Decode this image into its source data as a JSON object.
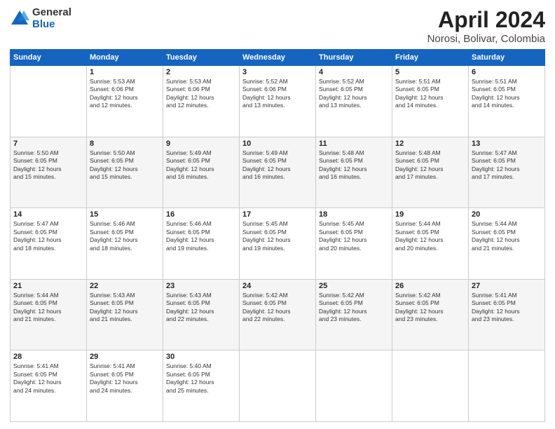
{
  "logo": {
    "general": "General",
    "blue": "Blue"
  },
  "title": "April 2024",
  "subtitle": "Norosi, Bolivar, Colombia",
  "days_of_week": [
    "Sunday",
    "Monday",
    "Tuesday",
    "Wednesday",
    "Thursday",
    "Friday",
    "Saturday"
  ],
  "weeks": [
    [
      {
        "day": "",
        "info": ""
      },
      {
        "day": "1",
        "info": "Sunrise: 5:53 AM\nSunset: 6:06 PM\nDaylight: 12 hours\nand 12 minutes."
      },
      {
        "day": "2",
        "info": "Sunrise: 5:53 AM\nSunset: 6:06 PM\nDaylight: 12 hours\nand 12 minutes."
      },
      {
        "day": "3",
        "info": "Sunrise: 5:52 AM\nSunset: 6:06 PM\nDaylight: 12 hours\nand 13 minutes."
      },
      {
        "day": "4",
        "info": "Sunrise: 5:52 AM\nSunset: 6:05 PM\nDaylight: 12 hours\nand 13 minutes."
      },
      {
        "day": "5",
        "info": "Sunrise: 5:51 AM\nSunset: 6:05 PM\nDaylight: 12 hours\nand 14 minutes."
      },
      {
        "day": "6",
        "info": "Sunrise: 5:51 AM\nSunset: 6:05 PM\nDaylight: 12 hours\nand 14 minutes."
      }
    ],
    [
      {
        "day": "7",
        "info": "Sunrise: 5:50 AM\nSunset: 6:05 PM\nDaylight: 12 hours\nand 15 minutes."
      },
      {
        "day": "8",
        "info": "Sunrise: 5:50 AM\nSunset: 6:05 PM\nDaylight: 12 hours\nand 15 minutes."
      },
      {
        "day": "9",
        "info": "Sunrise: 5:49 AM\nSunset: 6:05 PM\nDaylight: 12 hours\nand 16 minutes."
      },
      {
        "day": "10",
        "info": "Sunrise: 5:49 AM\nSunset: 6:05 PM\nDaylight: 12 hours\nand 16 minutes."
      },
      {
        "day": "11",
        "info": "Sunrise: 5:48 AM\nSunset: 6:05 PM\nDaylight: 12 hours\nand 16 minutes."
      },
      {
        "day": "12",
        "info": "Sunrise: 5:48 AM\nSunset: 6:05 PM\nDaylight: 12 hours\nand 17 minutes."
      },
      {
        "day": "13",
        "info": "Sunrise: 5:47 AM\nSunset: 6:05 PM\nDaylight: 12 hours\nand 17 minutes."
      }
    ],
    [
      {
        "day": "14",
        "info": "Sunrise: 5:47 AM\nSunset: 6:05 PM\nDaylight: 12 hours\nand 18 minutes."
      },
      {
        "day": "15",
        "info": "Sunrise: 5:46 AM\nSunset: 6:05 PM\nDaylight: 12 hours\nand 18 minutes."
      },
      {
        "day": "16",
        "info": "Sunrise: 5:46 AM\nSunset: 6:05 PM\nDaylight: 12 hours\nand 19 minutes."
      },
      {
        "day": "17",
        "info": "Sunrise: 5:45 AM\nSunset: 6:05 PM\nDaylight: 12 hours\nand 19 minutes."
      },
      {
        "day": "18",
        "info": "Sunrise: 5:45 AM\nSunset: 6:05 PM\nDaylight: 12 hours\nand 20 minutes."
      },
      {
        "day": "19",
        "info": "Sunrise: 5:44 AM\nSunset: 6:05 PM\nDaylight: 12 hours\nand 20 minutes."
      },
      {
        "day": "20",
        "info": "Sunrise: 5:44 AM\nSunset: 6:05 PM\nDaylight: 12 hours\nand 21 minutes."
      }
    ],
    [
      {
        "day": "21",
        "info": "Sunrise: 5:44 AM\nSunset: 6:05 PM\nDaylight: 12 hours\nand 21 minutes."
      },
      {
        "day": "22",
        "info": "Sunrise: 5:43 AM\nSunset: 6:05 PM\nDaylight: 12 hours\nand 21 minutes."
      },
      {
        "day": "23",
        "info": "Sunrise: 5:43 AM\nSunset: 6:05 PM\nDaylight: 12 hours\nand 22 minutes."
      },
      {
        "day": "24",
        "info": "Sunrise: 5:42 AM\nSunset: 6:05 PM\nDaylight: 12 hours\nand 22 minutes."
      },
      {
        "day": "25",
        "info": "Sunrise: 5:42 AM\nSunset: 6:05 PM\nDaylight: 12 hours\nand 23 minutes."
      },
      {
        "day": "26",
        "info": "Sunrise: 5:42 AM\nSunset: 6:05 PM\nDaylight: 12 hours\nand 23 minutes."
      },
      {
        "day": "27",
        "info": "Sunrise: 5:41 AM\nSunset: 6:05 PM\nDaylight: 12 hours\nand 23 minutes."
      }
    ],
    [
      {
        "day": "28",
        "info": "Sunrise: 5:41 AM\nSunset: 6:05 PM\nDaylight: 12 hours\nand 24 minutes."
      },
      {
        "day": "29",
        "info": "Sunrise: 5:41 AM\nSunset: 6:05 PM\nDaylight: 12 hours\nand 24 minutes."
      },
      {
        "day": "30",
        "info": "Sunrise: 5:40 AM\nSunset: 6:05 PM\nDaylight: 12 hours\nand 25 minutes."
      },
      {
        "day": "",
        "info": ""
      },
      {
        "day": "",
        "info": ""
      },
      {
        "day": "",
        "info": ""
      },
      {
        "day": "",
        "info": ""
      }
    ]
  ]
}
